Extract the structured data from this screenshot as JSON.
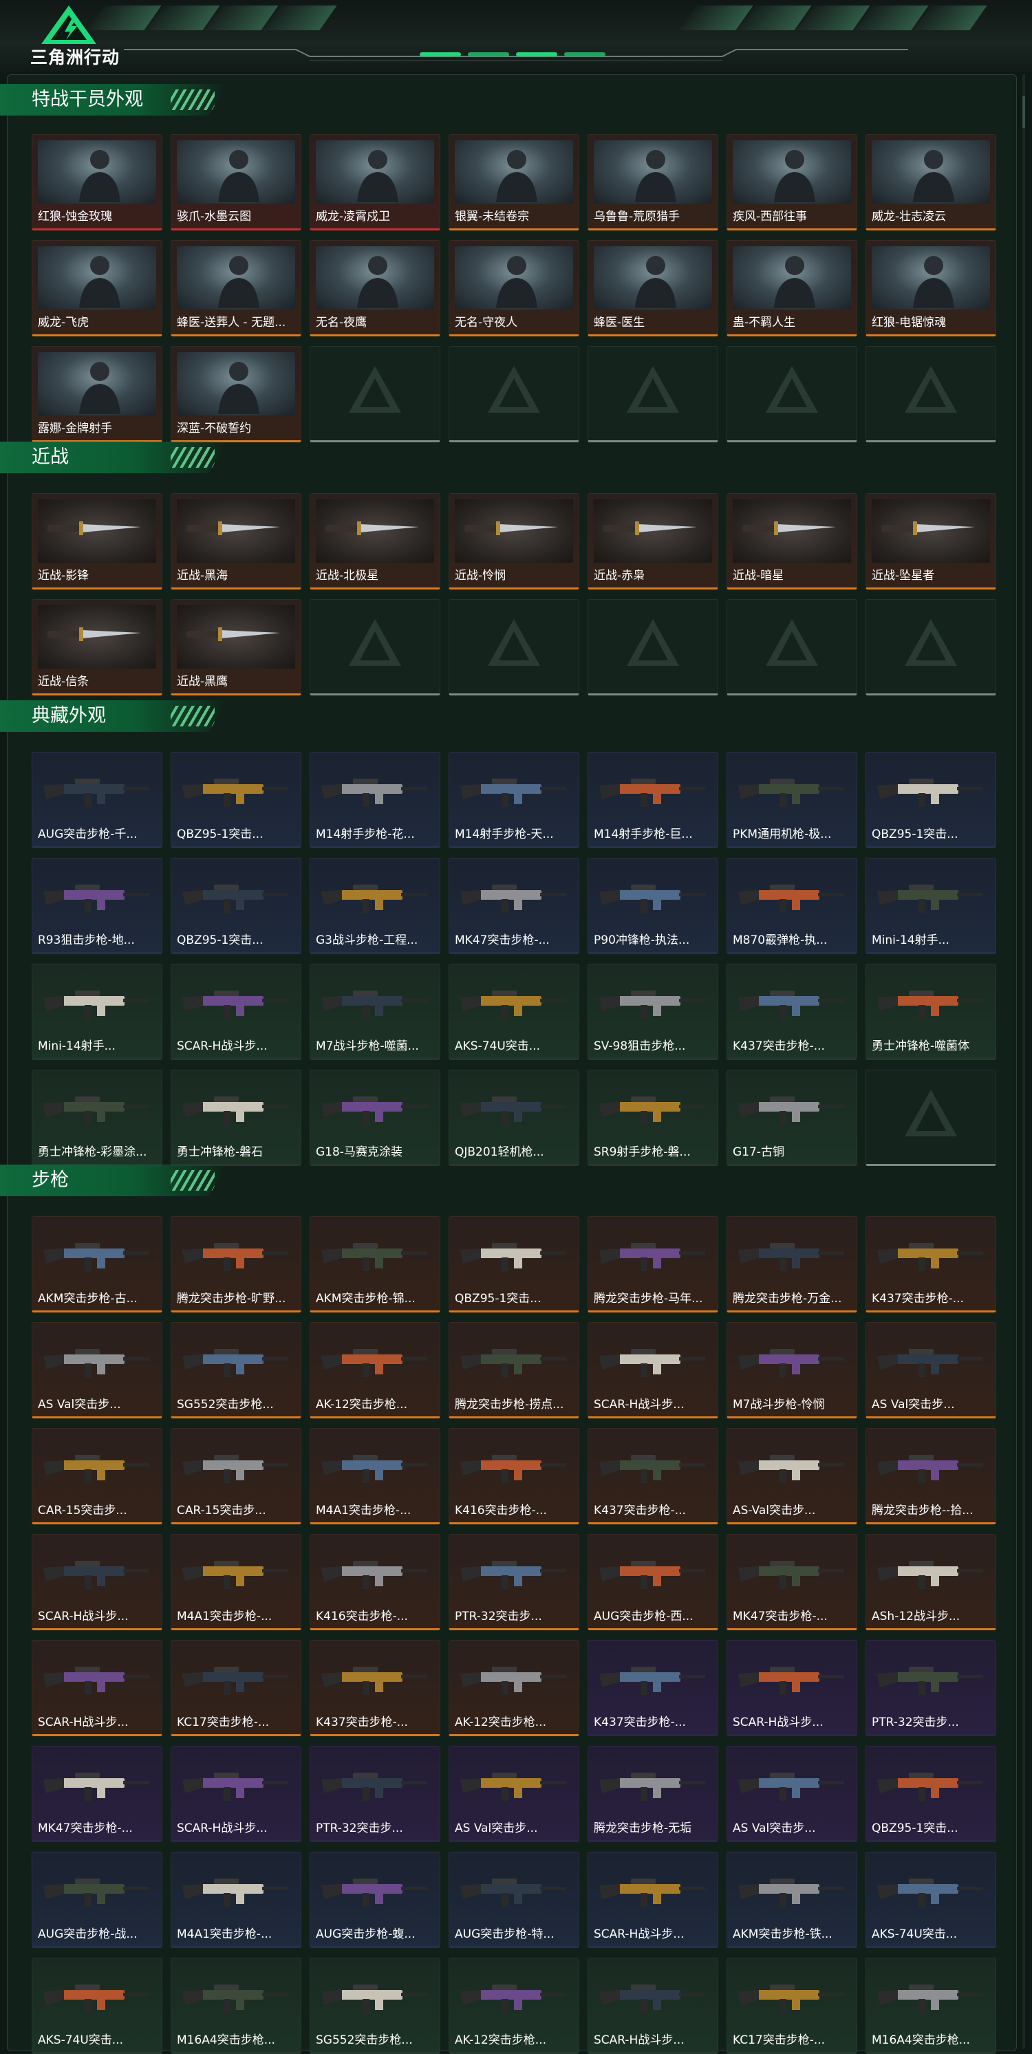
{
  "app": {
    "brand": "三角洲行动"
  },
  "colors": {
    "orange": "#d97a1f",
    "red": "#c9302c",
    "blue": "#2b6cd6",
    "purple": "#8b3ce0",
    "green": "#2bc06a",
    "accent": "#1ea55a"
  },
  "sections": [
    {
      "title": "特战干员外观",
      "kind": "person",
      "empty_slots": 5,
      "items": [
        {
          "label": "红狼-蚀金玫瑰",
          "rarity": "red"
        },
        {
          "label": "骇爪-水墨云图",
          "rarity": "red"
        },
        {
          "label": "威龙-凌霄戍卫",
          "rarity": "red"
        },
        {
          "label": "银翼-未结卷宗",
          "rarity": "orange"
        },
        {
          "label": "乌鲁鲁-荒原猎手",
          "rarity": "orange"
        },
        {
          "label": "疾风-西部往事",
          "rarity": "orange"
        },
        {
          "label": "威龙-壮志凌云",
          "rarity": "orange"
        },
        {
          "label": "威龙-飞虎",
          "rarity": "orange"
        },
        {
          "label": "蜂医-送葬人 - 无题...",
          "rarity": "orange"
        },
        {
          "label": "无名-夜鹰",
          "rarity": "orange"
        },
        {
          "label": "无名-守夜人",
          "rarity": "orange"
        },
        {
          "label": "蜂医-医生",
          "rarity": "orange"
        },
        {
          "label": "蛊-不羁人生",
          "rarity": "orange"
        },
        {
          "label": "红狼-电锯惊魂",
          "rarity": "orange"
        },
        {
          "label": "露娜-金牌射手",
          "rarity": "orange"
        },
        {
          "label": "深蓝-不破誓约",
          "rarity": "orange"
        }
      ]
    },
    {
      "title": "近战",
      "kind": "knife",
      "empty_slots": 5,
      "items": [
        {
          "label": "近战-影锋",
          "rarity": "orange"
        },
        {
          "label": "近战-黑海",
          "rarity": "orange"
        },
        {
          "label": "近战-北极星",
          "rarity": "orange"
        },
        {
          "label": "近战-怜悯",
          "rarity": "orange"
        },
        {
          "label": "近战-赤枭",
          "rarity": "orange"
        },
        {
          "label": "近战-暗星",
          "rarity": "orange"
        },
        {
          "label": "近战-坠星者",
          "rarity": "orange"
        },
        {
          "label": "近战-信条",
          "rarity": "orange"
        },
        {
          "label": "近战-黑鹰",
          "rarity": "orange"
        }
      ]
    },
    {
      "title": "典藏外观",
      "kind": "gun",
      "empty_slots": 1,
      "items": [
        {
          "label": "AUG突击步枪-千...",
          "rarity": "blue"
        },
        {
          "label": "QBZ95-1突击...",
          "rarity": "blue"
        },
        {
          "label": "M14射手步枪-花...",
          "rarity": "blue"
        },
        {
          "label": "M14射手步枪-天...",
          "rarity": "blue"
        },
        {
          "label": "M14射手步枪-巨...",
          "rarity": "blue"
        },
        {
          "label": "PKM通用机枪-极...",
          "rarity": "blue"
        },
        {
          "label": "QBZ95-1突击...",
          "rarity": "blue"
        },
        {
          "label": "R93狙击步枪-地...",
          "rarity": "blue"
        },
        {
          "label": "QBZ95-1突击...",
          "rarity": "blue"
        },
        {
          "label": "G3战斗步枪-工程...",
          "rarity": "blue"
        },
        {
          "label": "MK47突击步枪-...",
          "rarity": "blue"
        },
        {
          "label": "P90冲锋枪-执法...",
          "rarity": "blue"
        },
        {
          "label": "M870霰弹枪-执...",
          "rarity": "blue"
        },
        {
          "label": "Mini-14射手...",
          "rarity": "blue"
        },
        {
          "label": "Mini-14射手...",
          "rarity": "green"
        },
        {
          "label": "SCAR-H战斗步...",
          "rarity": "green"
        },
        {
          "label": "M7战斗步枪-噬菌...",
          "rarity": "green"
        },
        {
          "label": "AKS-74U突击...",
          "rarity": "green"
        },
        {
          "label": "SV-98狙击步枪...",
          "rarity": "green"
        },
        {
          "label": "K437突击步枪-...",
          "rarity": "green"
        },
        {
          "label": "勇士冲锋枪-噬菌体",
          "rarity": "green"
        },
        {
          "label": "勇士冲锋枪-彩墨涂...",
          "rarity": "green"
        },
        {
          "label": "勇士冲锋枪-磐石",
          "rarity": "green"
        },
        {
          "label": "G18-马赛克涂装",
          "rarity": "green"
        },
        {
          "label": "QJB201轻机枪...",
          "rarity": "green"
        },
        {
          "label": "SR9射手步枪-磐...",
          "rarity": "green"
        },
        {
          "label": "G17-古铜",
          "rarity": "green"
        }
      ]
    },
    {
      "title": "步枪",
      "kind": "gun",
      "empty_slots": 0,
      "items": [
        {
          "label": "AKM突击步枪-古...",
          "rarity": "orange"
        },
        {
          "label": "腾龙突击步枪-旷野...",
          "rarity": "orange"
        },
        {
          "label": "AKM突击步枪-锦...",
          "rarity": "orange"
        },
        {
          "label": "QBZ95-1突击...",
          "rarity": "orange"
        },
        {
          "label": "腾龙突击步枪-马年...",
          "rarity": "orange"
        },
        {
          "label": "腾龙突击步枪-万金...",
          "rarity": "orange"
        },
        {
          "label": "K437突击步枪-...",
          "rarity": "orange"
        },
        {
          "label": "AS Val突击步...",
          "rarity": "orange"
        },
        {
          "label": "SG552突击步枪...",
          "rarity": "orange"
        },
        {
          "label": "AK-12突击步枪...",
          "rarity": "orange"
        },
        {
          "label": "腾龙突击步枪-捞点...",
          "rarity": "orange"
        },
        {
          "label": "SCAR-H战斗步...",
          "rarity": "orange"
        },
        {
          "label": "M7战斗步枪-怜悯",
          "rarity": "orange"
        },
        {
          "label": "AS Val突击步...",
          "rarity": "orange"
        },
        {
          "label": "CAR-15突击步...",
          "rarity": "orange"
        },
        {
          "label": "CAR-15突击步...",
          "rarity": "orange"
        },
        {
          "label": "M4A1突击步枪-...",
          "rarity": "orange"
        },
        {
          "label": "K416突击步枪-...",
          "rarity": "orange"
        },
        {
          "label": "K437突击步枪-...",
          "rarity": "orange"
        },
        {
          "label": "AS-Val突击步...",
          "rarity": "orange"
        },
        {
          "label": "腾龙突击步枪--拾...",
          "rarity": "orange"
        },
        {
          "label": "SCAR-H战斗步...",
          "rarity": "orange"
        },
        {
          "label": "M4A1突击步枪-...",
          "rarity": "orange"
        },
        {
          "label": "K416突击步枪-...",
          "rarity": "orange"
        },
        {
          "label": "PTR-32突击步...",
          "rarity": "orange"
        },
        {
          "label": "AUG突击步枪-西...",
          "rarity": "orange"
        },
        {
          "label": "MK47突击步枪-...",
          "rarity": "orange"
        },
        {
          "label": "ASh-12战斗步...",
          "rarity": "orange"
        },
        {
          "label": "SCAR-H战斗步...",
          "rarity": "orange"
        },
        {
          "label": "KC17突击步枪-...",
          "rarity": "orange"
        },
        {
          "label": "K437突击步枪-...",
          "rarity": "orange"
        },
        {
          "label": "AK-12突击步枪...",
          "rarity": "orange"
        },
        {
          "label": "K437突击步枪-...",
          "rarity": "purple"
        },
        {
          "label": "SCAR-H战斗步...",
          "rarity": "purple"
        },
        {
          "label": "PTR-32突击步...",
          "rarity": "purple"
        },
        {
          "label": "MK47突击步枪-...",
          "rarity": "purple"
        },
        {
          "label": "SCAR-H战斗步...",
          "rarity": "purple"
        },
        {
          "label": "PTR-32突击步...",
          "rarity": "purple"
        },
        {
          "label": "AS Val突击步...",
          "rarity": "purple"
        },
        {
          "label": "腾龙突击步枪-无垢",
          "rarity": "purple"
        },
        {
          "label": "AS Val突击步...",
          "rarity": "purple"
        },
        {
          "label": "QBZ95-1突击...",
          "rarity": "purple"
        },
        {
          "label": "AUG突击步枪-战...",
          "rarity": "blue"
        },
        {
          "label": "M4A1突击步枪-...",
          "rarity": "blue"
        },
        {
          "label": "AUG突击步枪-蝮...",
          "rarity": "blue"
        },
        {
          "label": "AUG突击步枪-特...",
          "rarity": "blue"
        },
        {
          "label": "SCAR-H战斗步...",
          "rarity": "blue"
        },
        {
          "label": "AKM突击步枪-铁...",
          "rarity": "blue"
        },
        {
          "label": "AKS-74U突击...",
          "rarity": "blue"
        },
        {
          "label": "AKS-74U突击...",
          "rarity": "green"
        },
        {
          "label": "M16A4突击步枪...",
          "rarity": "green"
        },
        {
          "label": "SG552突击步枪...",
          "rarity": "green"
        },
        {
          "label": "AK-12突击步枪...",
          "rarity": "green"
        },
        {
          "label": "SCAR-H战斗步...",
          "rarity": "green"
        },
        {
          "label": "KC17突击步枪-...",
          "rarity": "green"
        },
        {
          "label": "M16A4突击步枪...",
          "rarity": "green"
        }
      ]
    }
  ]
}
